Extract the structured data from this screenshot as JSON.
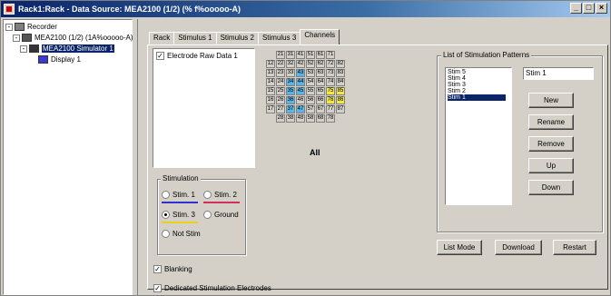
{
  "window": {
    "title": "Rack1:Rack - Data Source: MEA2100 (1/2) (% f%ooooo-A)",
    "buttons": [
      "_",
      "□",
      "×"
    ]
  },
  "tree": {
    "items": [
      {
        "label": "Recorder",
        "icon": "recorder-icon",
        "expander": "-"
      },
      {
        "label": "MEA2100 (1/2) (1A%ooooo-A)",
        "icon": "mea-device-icon",
        "expander": "-"
      },
      {
        "label": "MEA2100 Simulator 1",
        "icon": "simulator-icon",
        "expander": "-"
      },
      {
        "label": "Display 1",
        "icon": "display-icon"
      }
    ]
  },
  "tabs": [
    "Rack",
    "Stimulus 1",
    "Stimulus 2",
    "Stimulus 3",
    "Channels"
  ],
  "active_tab": "Channels",
  "channels": {
    "electrode_list": [
      {
        "label": "Electrode Raw Data 1",
        "checked": true
      }
    ],
    "grid_rows": [
      [
        "21",
        "31",
        "41",
        "51",
        "61",
        "71"
      ],
      [
        "12",
        "22",
        "32",
        "42",
        "52",
        "62",
        "72",
        "82"
      ],
      [
        "13",
        "23",
        "33",
        "43",
        "53",
        "63",
        "73",
        "83"
      ],
      [
        "14",
        "24",
        "34",
        "44",
        "54",
        "64",
        "74",
        "84"
      ],
      [
        "15",
        "25",
        "35",
        "45",
        "55",
        "65",
        "75",
        "85"
      ],
      [
        "16",
        "26",
        "36",
        "46",
        "56",
        "66",
        "76",
        "86"
      ],
      [
        "17",
        "27",
        "37",
        "47",
        "57",
        "67",
        "77",
        "87"
      ],
      [
        "28",
        "38",
        "48",
        "58",
        "68",
        "78"
      ]
    ],
    "highlight_blue": [
      "43",
      "34",
      "44",
      "35",
      "45",
      "36",
      "37",
      "47"
    ],
    "highlight_yellow": [
      "75",
      "85",
      "76",
      "86"
    ],
    "all_label": "All"
  },
  "stimulation": {
    "group_label": "Stimulation",
    "options": [
      {
        "label": "Stim. 1",
        "checked": false,
        "color": "#3030d0"
      },
      {
        "label": "Stim. 2",
        "checked": false,
        "color": "#d03060"
      },
      {
        "label": "Stim. 3",
        "checked": true,
        "color": "#e8d020"
      },
      {
        "label": "Ground",
        "checked": false
      },
      {
        "label": "Not Stim",
        "checked": false
      }
    ]
  },
  "options": {
    "blanking": {
      "label": "Blanking",
      "checked": true
    },
    "dedicated": {
      "label": "Dedicated Stimulation Electrodes",
      "checked": true
    }
  },
  "patterns": {
    "group_label": "List of Stimulation Patterns",
    "items": [
      "Stim 5",
      "Stim 4",
      "Stim 3",
      "Stim 2",
      "Stim 1"
    ],
    "selected": "Stim 1",
    "name_value": "Stim 1",
    "buttons": {
      "new": "New",
      "rename": "Rename",
      "remove": "Remove",
      "up": "Up",
      "down": "Down"
    }
  },
  "bottom_buttons": {
    "list_mode": "List Mode",
    "download": "Download",
    "restart": "Restart"
  }
}
